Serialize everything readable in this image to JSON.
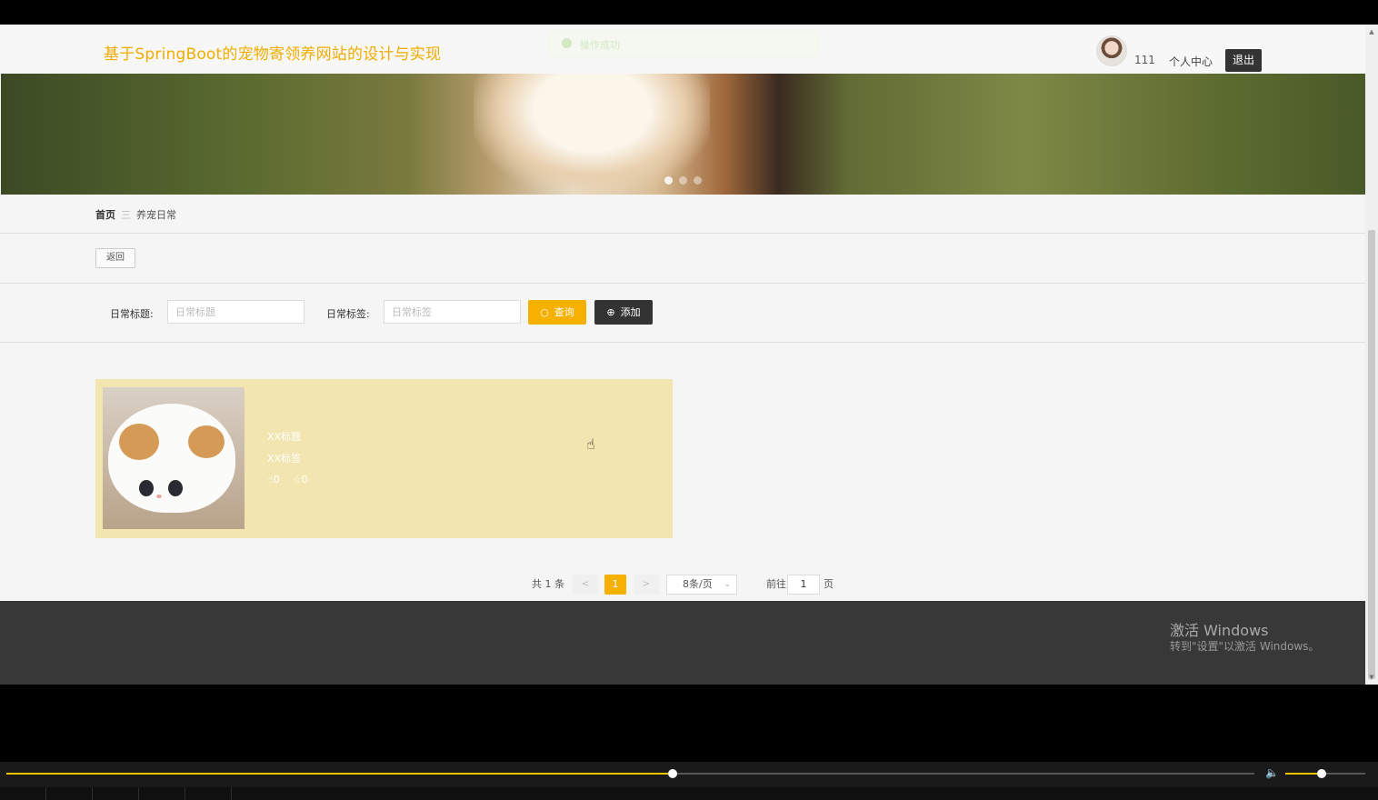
{
  "header": {
    "site_title": "基于SpringBoot的宠物寄领养网站的设计与实现",
    "toast": "操作成功",
    "username": "111",
    "profile_link": "个人中心",
    "logout": "退出"
  },
  "breadcrumb": {
    "home": "首页",
    "separator": "三",
    "current": "养宠日常"
  },
  "back_button": "返回",
  "filters": {
    "title_label": "日常标题:",
    "title_placeholder": "日常标题",
    "tag_label": "日常标签:",
    "tag_placeholder": "日常标签",
    "search_button": "查询",
    "add_button": "添加"
  },
  "list": [
    {
      "title": "XX标题",
      "tag": "XX标签",
      "likes": "0",
      "collects": "0"
    }
  ],
  "pagination": {
    "total": "共 1 条",
    "prev": "<",
    "current_page": "1",
    "next": ">",
    "page_size": "8条/页",
    "goto_label": "前往",
    "goto_value": "1",
    "page_suffix": "页"
  },
  "watermark": {
    "title": "激活 Windows",
    "subtitle": "转到\"设置\"以激活 Windows。"
  },
  "player": {
    "progress": 0.49,
    "volume": 0.45
  },
  "colors": {
    "accent": "#f5b000",
    "title": "#f0ad00",
    "footer": "#383838",
    "card": "#f3e5b0"
  }
}
